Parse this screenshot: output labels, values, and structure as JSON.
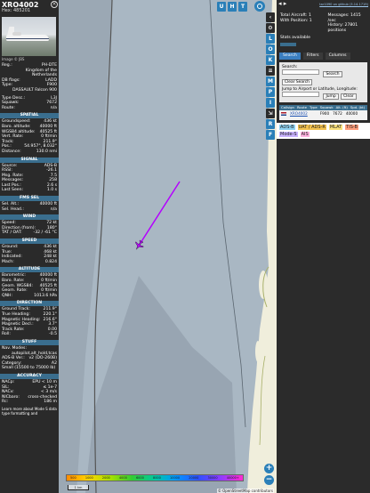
{
  "aircraft": {
    "callsign": "XRO4002",
    "hex_label": "Hex: 485201",
    "photo_credit": "Image © JBS",
    "registration_label": "Reg.:",
    "registration": "PH-DTE",
    "country": "Kingdom of the Netherlands",
    "db_flags_label": "DB flags:",
    "db_flags": "LADD",
    "type_label": "Type:",
    "type": "F900",
    "type_full": "DASSAULT Falcon 900",
    "type_desc_label": "Type Desc.:",
    "type_desc": "L3J",
    "squawk_label": "Squawk:",
    "squawk": "7672",
    "route_label": "Route:",
    "route": "n/a"
  },
  "sections": {
    "spatial": "SPATIAL",
    "signal": "SIGNAL",
    "fms": "FMS SEL",
    "wind": "WIND",
    "speed": "SPEED",
    "altitude": "ALTITUDE",
    "direction": "DIRECTION",
    "stuff": "STUFF",
    "accuracy": "ACCURACY"
  },
  "spatial": [
    {
      "k": "Groundspeed:",
      "v": "436 kt"
    },
    {
      "k": "Baro. altitude:",
      "v": "40000 ft"
    },
    {
      "k": "WGS84 altitude:",
      "v": "40525 ft"
    },
    {
      "k": "Vert. Rate:",
      "v": "0 ft/min"
    },
    {
      "k": "Track:",
      "v": "211.9°"
    },
    {
      "k": "Pos.:",
      "v": "54.957°, 8.032°"
    },
    {
      "k": "Distance:",
      "v": "130.0 nmi"
    }
  ],
  "signal": [
    {
      "k": "Source:",
      "v": "ADS-B"
    },
    {
      "k": "RSSI:",
      "v": "-26.1"
    },
    {
      "k": "Msg. Rate:",
      "v": "7.5"
    },
    {
      "k": "Messages:",
      "v": "258"
    },
    {
      "k": "Last Pos.:",
      "v": "2.6 s"
    },
    {
      "k": "Last Seen:",
      "v": "1.0 s"
    }
  ],
  "fms": [
    {
      "k": "Sel. Alt.:",
      "v": "40000 ft"
    },
    {
      "k": "Sel. Head.:",
      "v": "n/a"
    }
  ],
  "wind": [
    {
      "k": "Speed:",
      "v": "72 kt"
    },
    {
      "k": "Direction (from):",
      "v": "180°"
    },
    {
      "k": "TAT / OAT:",
      "v": "-32 / -61 °C"
    }
  ],
  "speed": [
    {
      "k": "Ground:",
      "v": "436 kt"
    },
    {
      "k": "True:",
      "v": "468 kt"
    },
    {
      "k": "Indicated:",
      "v": "248 kt"
    },
    {
      "k": "Mach:",
      "v": "0.824"
    }
  ],
  "altitude": [
    {
      "k": "Barometric:",
      "v": "40000 ft"
    },
    {
      "k": "Baro. Rate:",
      "v": "0 ft/min"
    },
    {
      "k": "Geom. WGS84:",
      "v": "40525 ft"
    },
    {
      "k": "Geom. Rate:",
      "v": "0 ft/min"
    },
    {
      "k": "QNH:",
      "v": "1013.6 hPa"
    }
  ],
  "direction": [
    {
      "k": "Ground Track:",
      "v": "211.9°"
    },
    {
      "k": "True Heading:",
      "v": "220.1°"
    },
    {
      "k": "Magnetic Heading:",
      "v": "216.6°"
    },
    {
      "k": "Magnetic Decl.:",
      "v": "3.7°"
    },
    {
      "k": "Track Rate:",
      "v": "0.00"
    },
    {
      "k": "Roll:",
      "v": "-0.5"
    }
  ],
  "stuff": {
    "nav_modes_label": "Nav. Modes:",
    "nav_modes": "autopilot,alt_hold,tcas",
    "ads_ver_label": "ADS-B Ver.:",
    "ads_ver": "v2 (DO-260B)",
    "category_label": "Category:",
    "category": "A2",
    "category_desc": "Small (15500 to 75000 lb)"
  },
  "accuracy": [
    {
      "k": "NACp:",
      "v": "EPU < 10 m"
    },
    {
      "k": "SIL:",
      "v": "≤ 1e-7"
    },
    {
      "k": "NACv:",
      "v": "< 3 m/s"
    },
    {
      "k": "NICbaro:",
      "v": "cross-checked"
    },
    {
      "k": "Rc:",
      "v": "186 m"
    }
  ],
  "footer_text": "Learn more about Mode S data type formatting and",
  "map": {
    "top_buttons": [
      "U",
      "H",
      "T"
    ],
    "side_buttons": [
      "L",
      "O",
      "K",
      "M",
      "P",
      "I",
      "R",
      "F"
    ],
    "zoom_in": "+",
    "zoom_out": "−",
    "scale": "1 km",
    "attribution": "© OpenStreetMap contributors",
    "altitude_labels": [
      "500",
      "1000",
      "2000",
      "4000",
      "6000",
      "8000",
      "10000",
      "20000",
      "30000",
      "40000+"
    ],
    "track_color": "#b400ff",
    "sea_color": "#a9b7c3",
    "land_color": "#f0eedc"
  },
  "right": {
    "arrows": "◂ ▸",
    "github_link": "tar1090 on github (3.14.1719)",
    "total_aircraft": "Total Aircraft: 1",
    "with_position": "With Position: 1",
    "messages": "Messages: 1415 /sec",
    "history": "History: 27801 positions",
    "stats_available": "Stats available",
    "tabs": [
      "Search",
      "Filters",
      "Columns"
    ],
    "search_label": "Search:",
    "search_button": "Search",
    "clear_search": "Clear Search",
    "jump_label": "Jump to Airport or Latitude, Longitude:",
    "jump_button": "Jump",
    "clear_button": "Clear",
    "columns": [
      "Callsign",
      "Route",
      "Type",
      "Squawk",
      "Alt. (ft)",
      "Spd. (kt)"
    ],
    "row": {
      "callsign": "XRO4002",
      "type": "F900",
      "squawk": "7672",
      "alt": "40000"
    },
    "sources": [
      "ADS-B",
      "UAT / ADS-R",
      "MLAT",
      "TIS-B",
      "Mode-S",
      "AIS"
    ]
  }
}
